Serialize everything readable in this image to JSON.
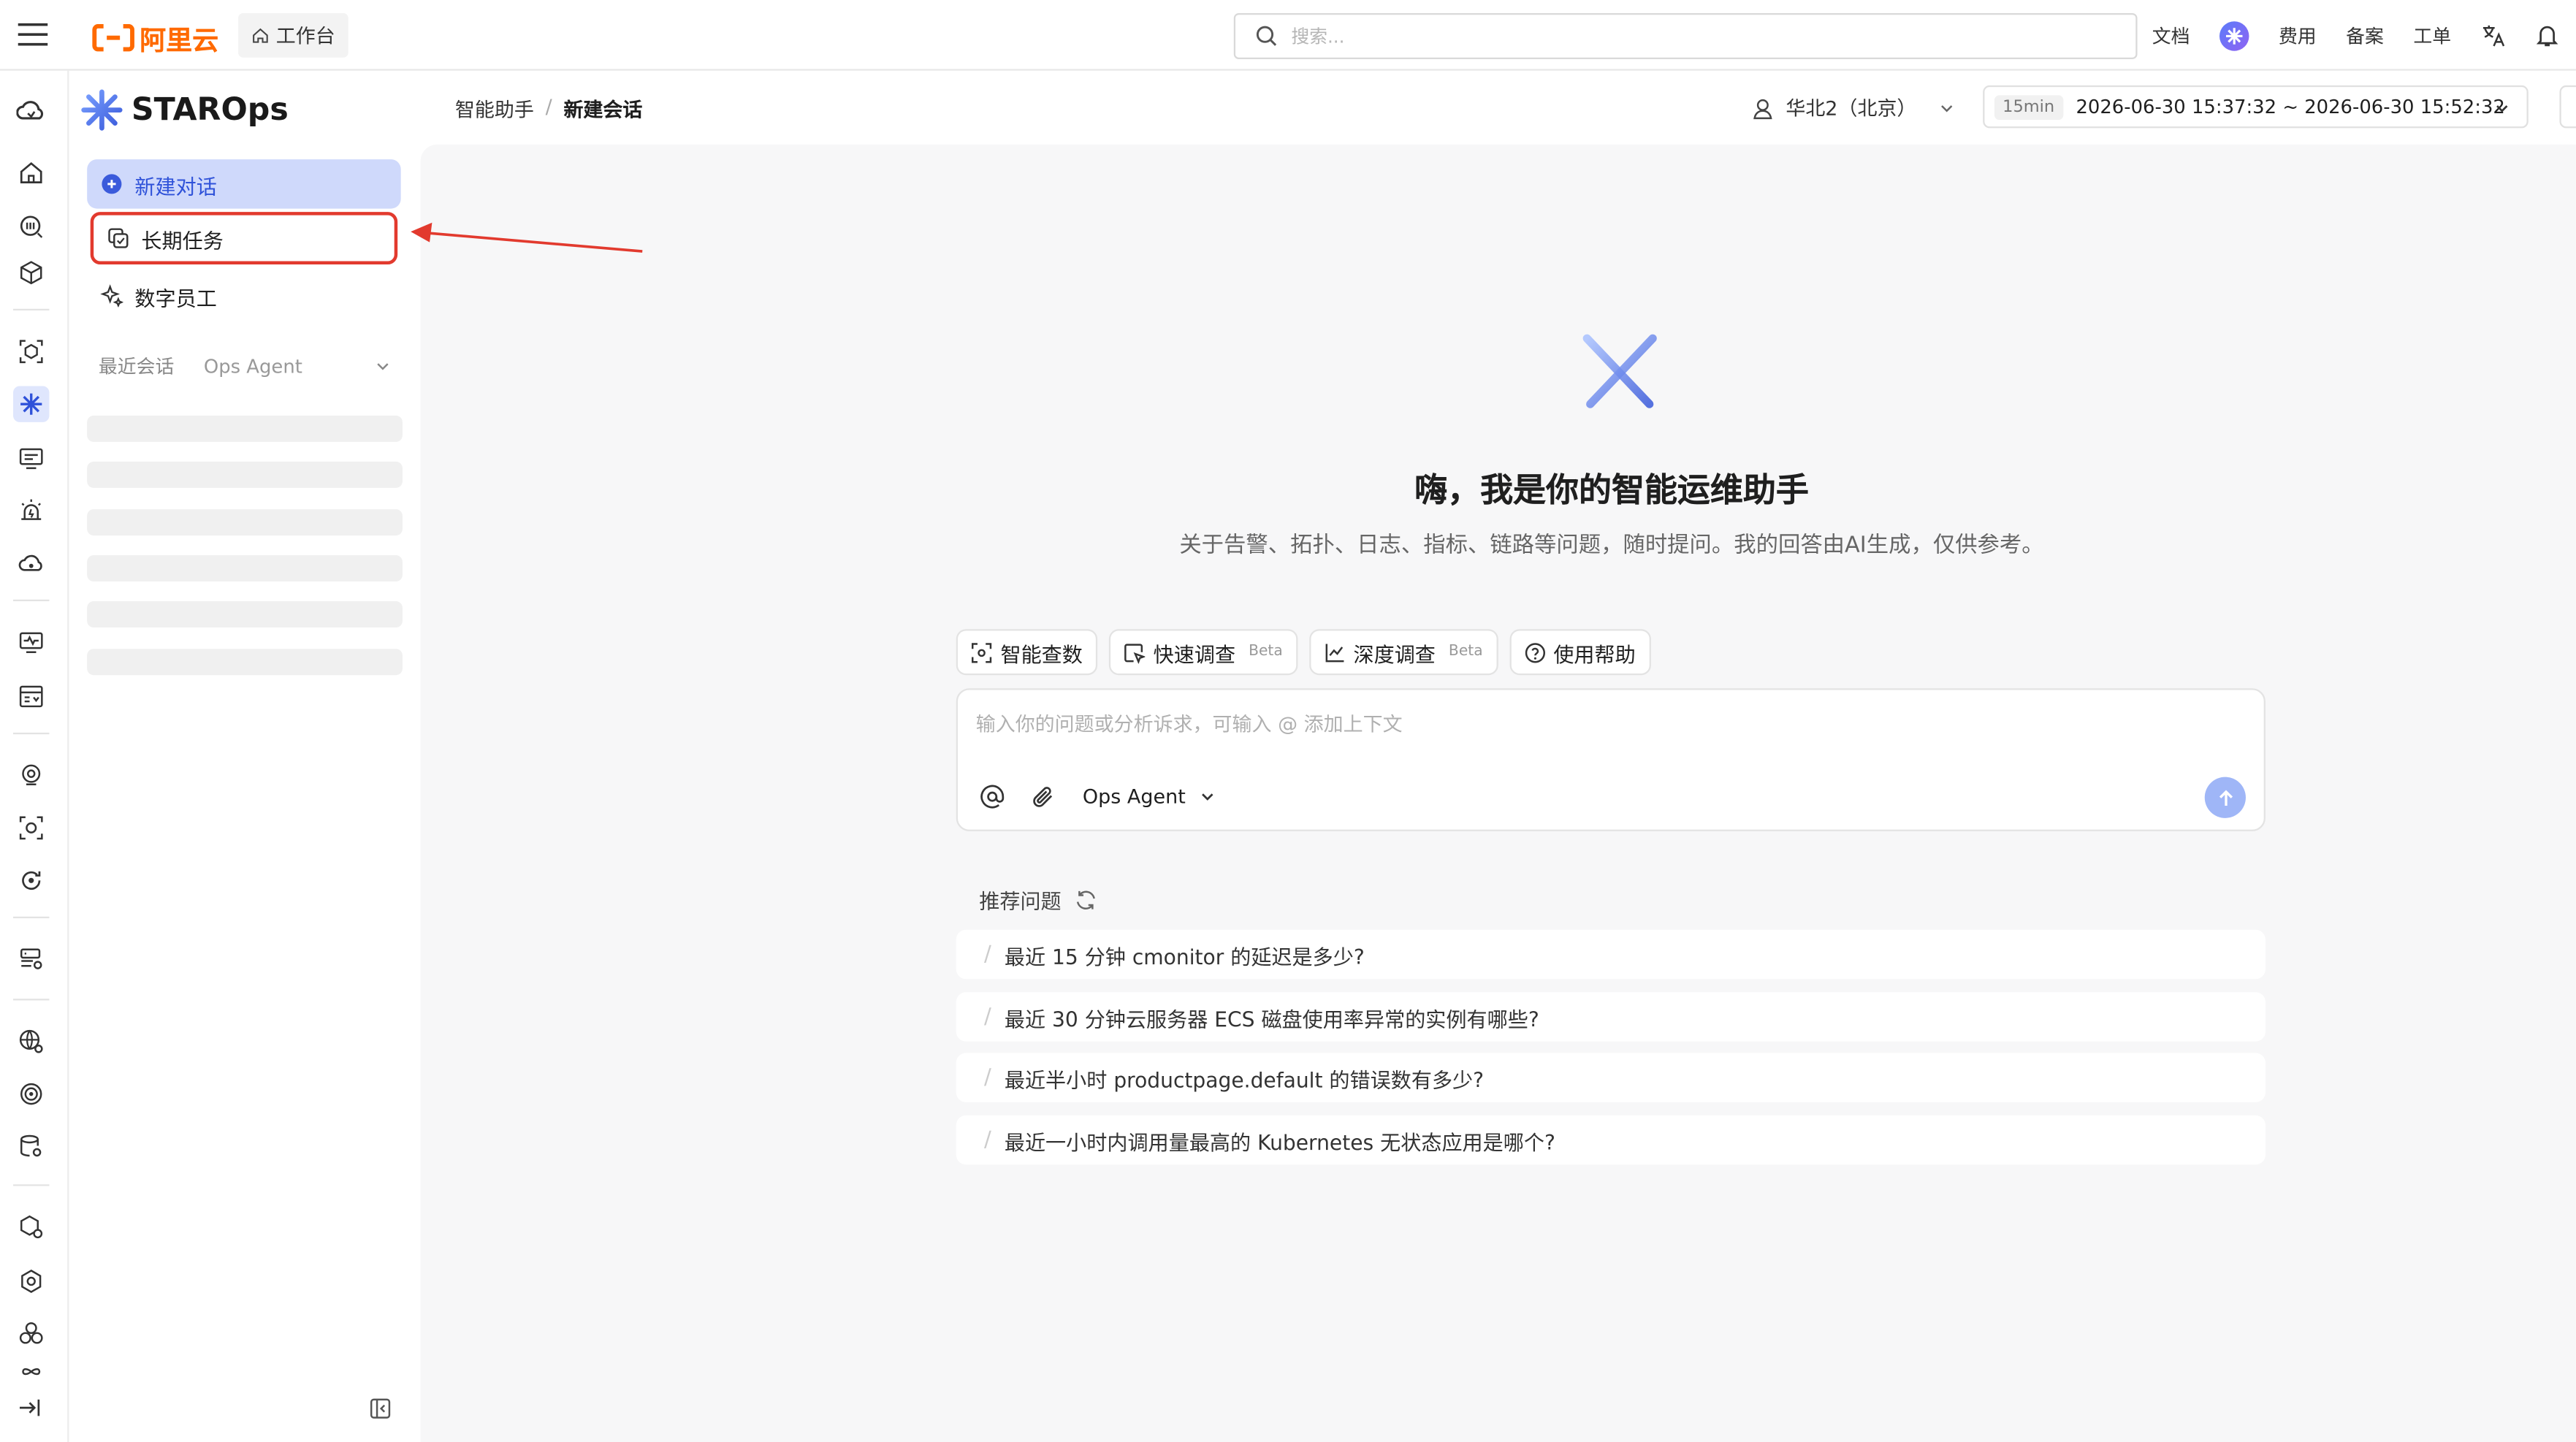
{
  "topbar": {
    "logo_text": "阿里云",
    "workbench_label": "工作台",
    "search_placeholder": "搜索...",
    "nav": [
      "文档",
      "费用",
      "备案",
      "工单"
    ]
  },
  "sidebar": {
    "brand": "STAROps",
    "items": [
      {
        "label": "新建对话",
        "icon": "chat-plus-icon",
        "active": true
      },
      {
        "label": "长期任务",
        "icon": "copy-task-icon",
        "highlighted": true
      },
      {
        "label": "数字员工",
        "icon": "sparkle-icon"
      }
    ],
    "recent_label": "最近会话",
    "recent_filter": "Ops Agent"
  },
  "header": {
    "breadcrumb": [
      "智能助手",
      "新建会话"
    ],
    "region": "华北2（北京）",
    "time_tag": "15min",
    "time_range": "2026-06-30 15:37:32 ~ 2026-06-30 15:52:32"
  },
  "main": {
    "title": "嗨，我是你的智能运维助手",
    "subtitle": "关于告警、拓扑、日志、指标、链路等问题，随时提问。我的回答由AI生成，仅供参考。",
    "chips": [
      {
        "label": "智能查数",
        "beta": ""
      },
      {
        "label": "快速调查",
        "beta": "Beta"
      },
      {
        "label": "深度调查",
        "beta": "Beta"
      },
      {
        "label": "使用帮助",
        "beta": ""
      }
    ],
    "input_placeholder": "输入你的问题或分析诉求，可输入 @ 添加上下文",
    "agent_select": "Ops Agent",
    "recommend_title": "推荐问题",
    "questions": [
      "最近 15 分钟 cmonitor 的延迟是多少?",
      "最近 30 分钟云服务器 ECS 磁盘使用率异常的实例有哪些?",
      "最近半小时 productpage.default 的错误数有多少?",
      "最近一小时内调用量最高的 Kubernetes 无状态应用是哪个?"
    ]
  },
  "colors": {
    "accent": "#3b5bdb",
    "brand_orange": "#ff6a00",
    "highlight_red": "#e23a2e",
    "active_bg": "#cfd9fb"
  }
}
